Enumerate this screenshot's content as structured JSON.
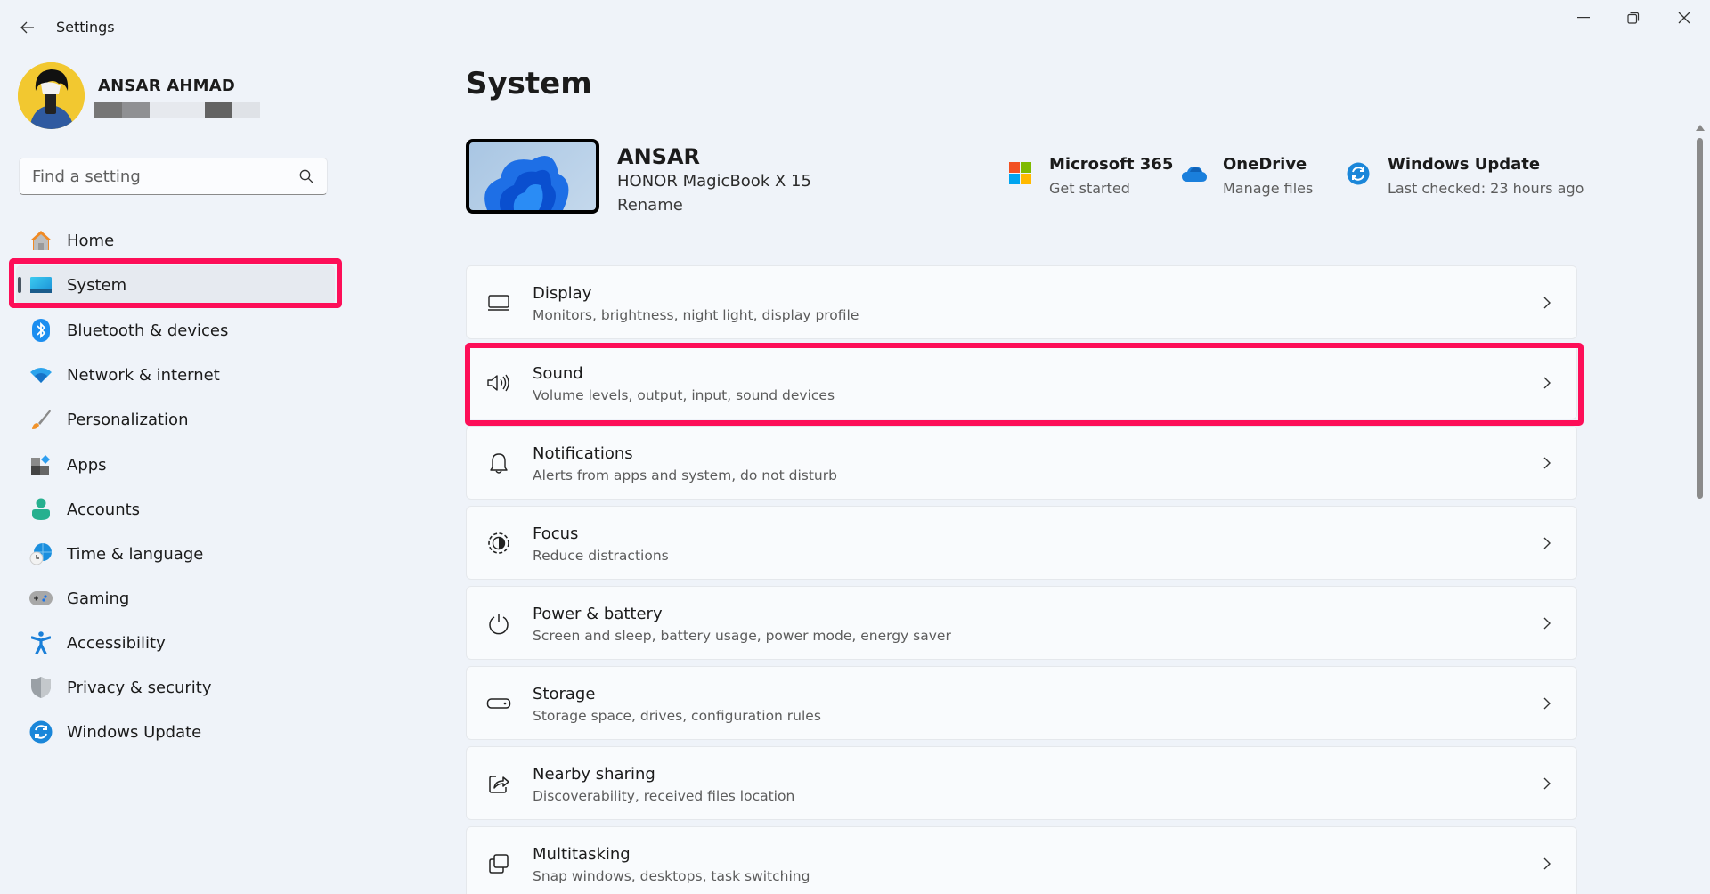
{
  "window": {
    "title": "Settings",
    "controls": {
      "minimize": "minimize",
      "restore": "restore",
      "close": "close"
    }
  },
  "profile": {
    "name": "ANSAR AHMAD",
    "email_redacted": true
  },
  "search": {
    "placeholder": "Find a setting",
    "value": ""
  },
  "sidebar": {
    "selected": "System",
    "items": [
      {
        "label": "Home",
        "icon": "home-icon"
      },
      {
        "label": "System",
        "icon": "system-icon"
      },
      {
        "label": "Bluetooth & devices",
        "icon": "bluetooth-icon"
      },
      {
        "label": "Network & internet",
        "icon": "wifi-icon"
      },
      {
        "label": "Personalization",
        "icon": "brush-icon"
      },
      {
        "label": "Apps",
        "icon": "apps-icon"
      },
      {
        "label": "Accounts",
        "icon": "accounts-icon"
      },
      {
        "label": "Time & language",
        "icon": "time-language-icon"
      },
      {
        "label": "Gaming",
        "icon": "gamepad-icon"
      },
      {
        "label": "Accessibility",
        "icon": "accessibility-icon"
      },
      {
        "label": "Privacy & security",
        "icon": "shield-icon"
      },
      {
        "label": "Windows Update",
        "icon": "windows-update-icon"
      }
    ]
  },
  "main": {
    "title": "System",
    "device": {
      "name": "ANSAR",
      "model": "HONOR MagicBook X 15",
      "rename_label": "Rename"
    },
    "quick_links": [
      {
        "title": "Microsoft 365",
        "subtitle": "Get started",
        "icon": "microsoft-365-icon"
      },
      {
        "title": "OneDrive",
        "subtitle": "Manage files",
        "icon": "onedrive-icon"
      },
      {
        "title": "Windows Update",
        "subtitle": "Last checked: 23 hours ago",
        "icon": "windows-update-icon"
      }
    ],
    "cards": [
      {
        "title": "Display",
        "subtitle": "Monitors, brightness, night light, display profile",
        "icon": "display-icon"
      },
      {
        "title": "Sound",
        "subtitle": "Volume levels, output, input, sound devices",
        "icon": "speaker-icon"
      },
      {
        "title": "Notifications",
        "subtitle": "Alerts from apps and system, do not disturb",
        "icon": "bell-icon"
      },
      {
        "title": "Focus",
        "subtitle": "Reduce distractions",
        "icon": "focus-icon"
      },
      {
        "title": "Power & battery",
        "subtitle": "Screen and sleep, battery usage, power mode, energy saver",
        "icon": "power-icon"
      },
      {
        "title": "Storage",
        "subtitle": "Storage space, drives, configuration rules",
        "icon": "storage-icon"
      },
      {
        "title": "Nearby sharing",
        "subtitle": "Discoverability, received files location",
        "icon": "share-icon"
      },
      {
        "title": "Multitasking",
        "subtitle": "Snap windows, desktops, task switching",
        "icon": "multitasking-icon"
      }
    ]
  },
  "annotations": {
    "highlight_color": "#fd0e58",
    "highlighted": [
      "System",
      "Sound"
    ]
  }
}
